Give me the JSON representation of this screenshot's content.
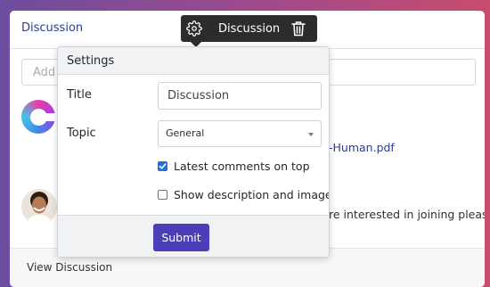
{
  "card": {
    "header_title": "Discussion",
    "add_input_placeholder": "Add a",
    "file_link": "-Human.pdf",
    "post_snippet": "re interested in joining please",
    "footer_link": "View Discussion"
  },
  "toolbar": {
    "label": "Discussion",
    "settings_icon": "gear-icon",
    "delete_icon": "trash-icon"
  },
  "settings": {
    "header": "Settings",
    "title_label": "Title",
    "title_value": "Discussion",
    "topic_label": "Topic",
    "topic_value": "General",
    "latest_on_top_label": "Latest comments on top",
    "latest_on_top_checked": true,
    "show_desc_label": "Show description and image",
    "show_desc_checked": false,
    "submit_label": "Submit"
  },
  "colors": {
    "accent": "#4a3fb8",
    "link": "#2a3d8f",
    "checkbox": "#1f6fe5",
    "toolbar_bg": "#2c2c2f"
  }
}
